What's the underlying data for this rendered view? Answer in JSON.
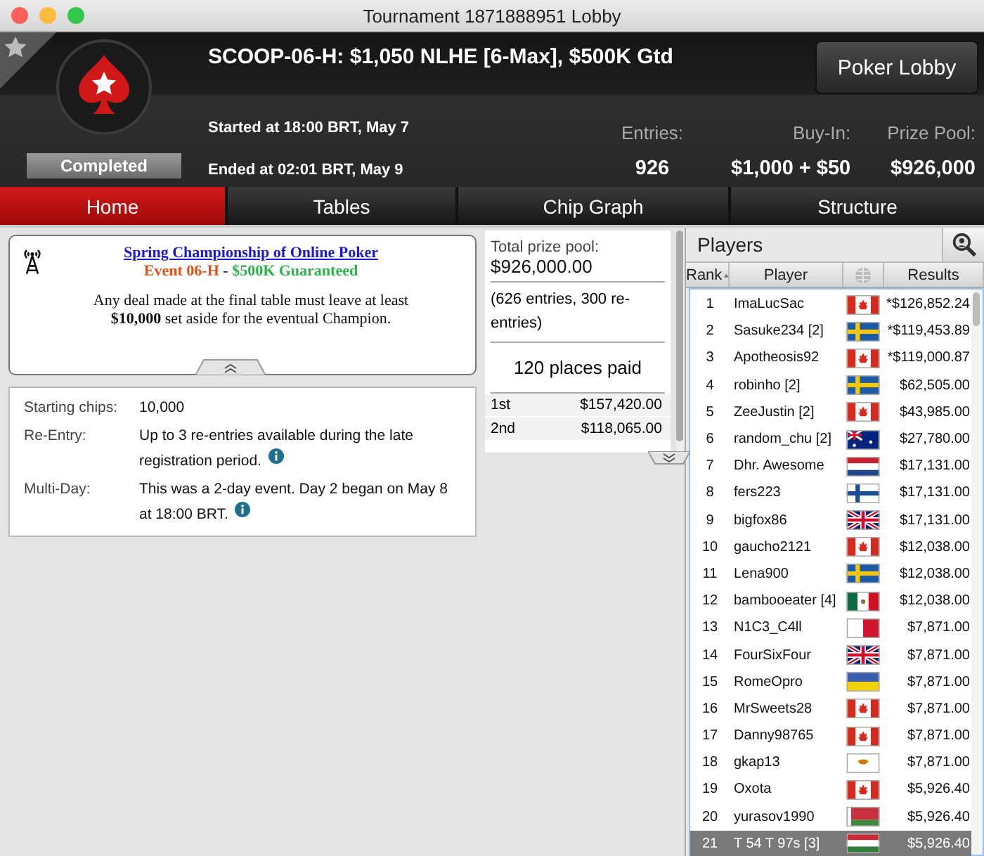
{
  "window": {
    "title": "Tournament 1871888951 Lobby"
  },
  "header": {
    "title": "SCOOP-06-H: $1,050 NLHE [6-Max], $500K Gtd",
    "status": "Completed",
    "started": "Started at 18:00 BRT, May 7",
    "ended": "Ended at 02:01 BRT, May 9",
    "favorite": false,
    "stats": [
      {
        "label": "Entries:",
        "value": "926"
      },
      {
        "label": "Buy-In:",
        "value": "$1,000 + $50"
      },
      {
        "label": "Prize Pool:",
        "value": "$926,000"
      }
    ],
    "lobby_button": "Poker Lobby"
  },
  "tabs": [
    {
      "label": "Home",
      "selected": true
    },
    {
      "label": "Tables",
      "selected": false
    },
    {
      "label": "Chip Graph",
      "selected": false
    },
    {
      "label": "Structure",
      "selected": false
    }
  ],
  "notice": {
    "link": "Spring Championship of Online Poker",
    "event": "Event 06-H",
    "separator": " - ",
    "guarantee": "$500K Guaranteed",
    "message": "Any deal made at the final table must leave at least **$10,000** set aside for the eventual Champion."
  },
  "details": [
    {
      "label": "Starting chips:",
      "value": "10,000",
      "info": false
    },
    {
      "label": "Re-Entry:",
      "value": "Up to 3 re-entries available during the late registration period.",
      "info": true
    },
    {
      "label": "Multi-Day:",
      "value": "This was a 2-day event. Day 2 began on May 8 at 18:00 BRT.",
      "info": true
    }
  ],
  "prizes": {
    "total_label": "Total prize pool:",
    "total": "$926,000.00",
    "entries_note": "(626 entries, 300 re-entries)",
    "places_paid": "120 places paid",
    "rows": [
      {
        "place": "1st",
        "amount": "$157,420.00"
      },
      {
        "place": "2nd",
        "amount": "$118,065.00"
      }
    ]
  },
  "players": {
    "title": "Players",
    "columns": [
      "Rank",
      "Player",
      "Results"
    ],
    "rows": [
      {
        "rank": "1",
        "player": "ImaLucSac",
        "kind": "ca",
        "result": "*$126,852.24",
        "selected": false
      },
      {
        "rank": "2",
        "player": "Sasuke234 [2]",
        "kind": "se",
        "result": "*$119,453.89",
        "selected": false
      },
      {
        "rank": "3",
        "player": "Apotheosis92",
        "kind": "ca",
        "result": "*$119,000.87",
        "selected": false
      },
      {
        "rank": "4",
        "player": "robinho [2]",
        "kind": "se",
        "result": "$62,505.00",
        "selected": false
      },
      {
        "rank": "5",
        "player": "ZeeJustin [2]",
        "kind": "ca",
        "result": "$43,985.00",
        "selected": false
      },
      {
        "rank": "6",
        "player": "random_chu [2]",
        "kind": "au",
        "result": "$27,780.00",
        "selected": false
      },
      {
        "rank": "7",
        "player": "Dhr. Awesome",
        "kind": "nl",
        "result": "$17,131.00",
        "selected": false
      },
      {
        "rank": "8",
        "player": "fers223",
        "kind": "fi",
        "result": "$17,131.00",
        "selected": false
      },
      {
        "rank": "9",
        "player": "bigfox86",
        "kind": "gb",
        "result": "$17,131.00",
        "selected": false
      },
      {
        "rank": "10",
        "player": "gaucho2121",
        "kind": "ca",
        "result": "$12,038.00",
        "selected": false
      },
      {
        "rank": "11",
        "player": "Lena900",
        "kind": "se",
        "result": "$12,038.00",
        "selected": false
      },
      {
        "rank": "12",
        "player": "bambooeater [4]",
        "kind": "mx",
        "result": "$12,038.00",
        "selected": false
      },
      {
        "rank": "13",
        "player": "N1C3_C4ll",
        "kind": "mt",
        "result": "$7,871.00",
        "selected": false
      },
      {
        "rank": "14",
        "player": "FourSixFour",
        "kind": "gb",
        "result": "$7,871.00",
        "selected": false
      },
      {
        "rank": "15",
        "player": "RomeOpro",
        "kind": "ua",
        "result": "$7,871.00",
        "selected": false
      },
      {
        "rank": "16",
        "player": "MrSweets28",
        "kind": "ca",
        "result": "$7,871.00",
        "selected": false
      },
      {
        "rank": "17",
        "player": "Danny98765",
        "kind": "ca",
        "result": "$7,871.00",
        "selected": false
      },
      {
        "rank": "18",
        "player": "gkap13",
        "kind": "cy",
        "result": "$7,871.00",
        "selected": false
      },
      {
        "rank": "19",
        "player": "Oxota",
        "kind": "ca",
        "result": "$5,926.40",
        "selected": false
      },
      {
        "rank": "20",
        "player": "yurasov1990",
        "kind": "by",
        "result": "$5,926.40",
        "selected": false
      },
      {
        "rank": "21",
        "player": "T 54 T 97s [3]",
        "kind": "hu",
        "result": "$5,926.40",
        "selected": true
      }
    ]
  }
}
